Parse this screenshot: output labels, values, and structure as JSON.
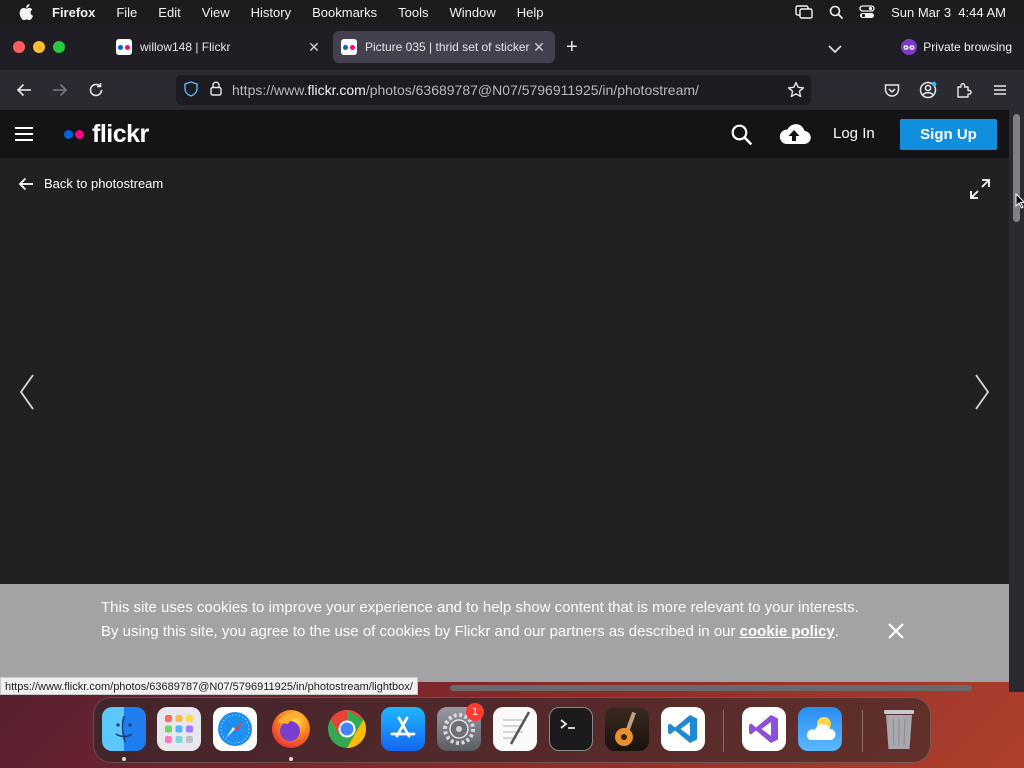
{
  "menubar": {
    "app_name": "Firefox",
    "items": [
      "File",
      "Edit",
      "View",
      "History",
      "Bookmarks",
      "Tools",
      "Window",
      "Help"
    ],
    "clock": "Sun Mar 3  4:44 AM"
  },
  "browser": {
    "tabs": [
      {
        "title": "willow148 | Flickr",
        "active": false
      },
      {
        "title": "Picture 035 | thrid set of sticker",
        "active": true
      }
    ],
    "private_label": "Private browsing",
    "url_prefix": "https://www.",
    "url_domain": "flickr.com",
    "url_path": "/photos/63689787@N07/5796911925/in/photostream/"
  },
  "flickr": {
    "logo_text": "flickr",
    "brand_colors": {
      "blue": "#0063dc",
      "pink": "#ff0084",
      "signup": "#128fdc"
    },
    "login_label": "Log In",
    "signup_label": "Sign Up",
    "back_label": "Back to photostream",
    "cookie": {
      "text": "This site uses cookies to improve your experience and to help show content that is more relevant to your interests. By using this site, you agree to the use of cookies by Flickr and our partners as described in our ",
      "link": "cookie policy",
      "suffix": "."
    }
  },
  "status_url": "https://www.flickr.com/photos/63689787@N07/5796911925/in/photostream/lightbox/",
  "dock": {
    "apps": [
      "finder-icon",
      "launchpad-icon",
      "safari-icon",
      "firefox-icon",
      "chrome-icon",
      "app-store-icon",
      "system-settings-icon",
      "textedit-icon",
      "terminal-icon",
      "garageband-icon",
      "vscode-icon",
      "visual-studio-icon",
      "weather-icon",
      "trash-icon"
    ],
    "settings_badge": "1"
  }
}
